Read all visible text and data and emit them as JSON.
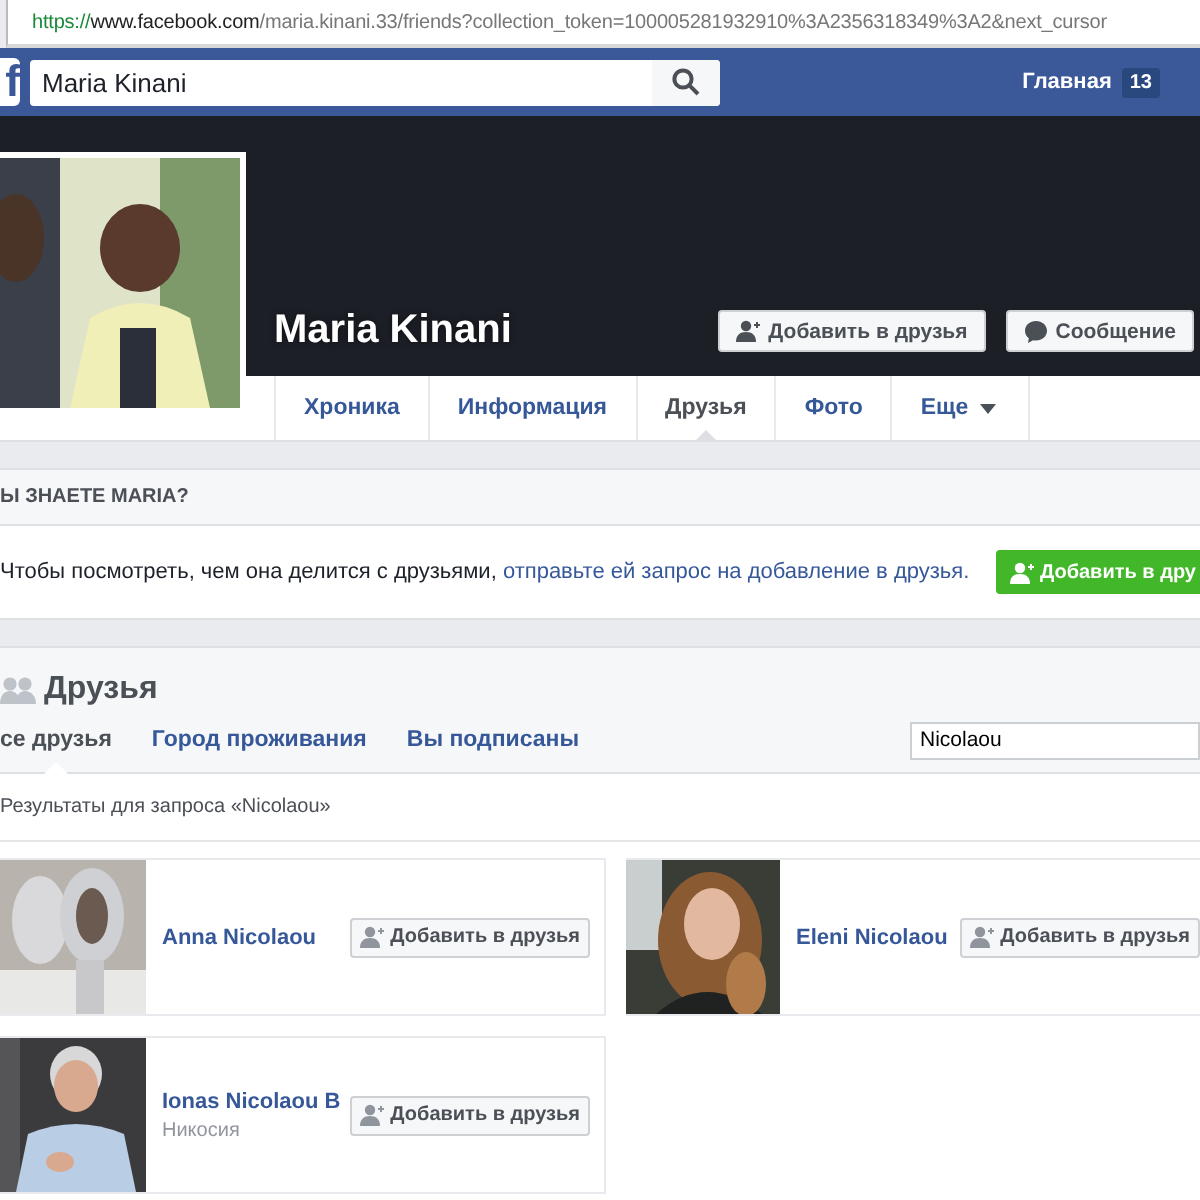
{
  "address_bar": {
    "scheme": "https://",
    "host": "www.facebook.com",
    "path": "/maria.kinani.33/friends?collection_token=100005281932910%3A2356318349%3A2&next_cursor"
  },
  "top_bar": {
    "logo": "f",
    "search": {
      "value": "Maria Kinani"
    },
    "home_link": "Главная",
    "notification_count": "13"
  },
  "profile": {
    "name": "Maria Kinani",
    "buttons": [
      {
        "kind": "add-friend",
        "label": "Добавить в друзья"
      },
      {
        "kind": "message",
        "label": "Сообщение"
      }
    ],
    "tabs": [
      {
        "label": "Хроника",
        "selected": false,
        "dropdown": false
      },
      {
        "label": "Информация",
        "selected": false,
        "dropdown": false
      },
      {
        "label": "Друзья",
        "selected": true,
        "dropdown": false
      },
      {
        "label": "Фото",
        "selected": false,
        "dropdown": false
      },
      {
        "label": "Еще",
        "selected": false,
        "dropdown": true
      }
    ]
  },
  "know_card": {
    "title": "Ы ЗНАЕТЕ MARIA?",
    "text": "Чтобы посмотреть, чем она делится с друзьями, ",
    "link": "отправьте ей запрос на добавление в друзья.",
    "button": "Добавить в дру"
  },
  "friends": {
    "title": "Друзья",
    "tabs": [
      {
        "label": "се друзья",
        "selected": true
      },
      {
        "label": "Город проживания",
        "selected": false
      },
      {
        "label": "Вы подписаны",
        "selected": false
      }
    ],
    "search": {
      "value": "Nicolaou"
    },
    "results_caption": "Результаты для запроса «Nicolaou»",
    "people": [
      {
        "name": "Anna Nicolaou",
        "button": "Добавить в друзья"
      },
      {
        "name": "Eleni Nicolaou",
        "button": "Добавить в друзья"
      },
      {
        "name": "Ionas Nicolaou B",
        "location": "Никосия",
        "button": "Добавить в друзья"
      }
    ]
  }
}
